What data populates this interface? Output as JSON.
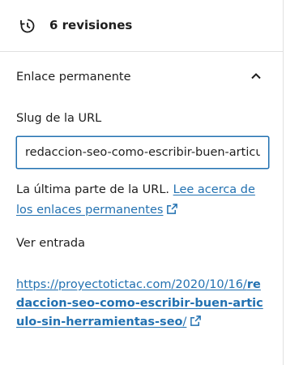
{
  "revisions": {
    "label": "6 revisiones",
    "icon": "history-icon"
  },
  "permalink_panel": {
    "title": "Enlace permanente",
    "toggle_icon": "chevron-up-icon",
    "slug_label": "Slug de la URL",
    "slug_value": "redaccion-seo-como-escribir-buen-articulo-sin-herramientas-seo",
    "help_text": "La última parte de la URL.",
    "help_link": "Lee acerca de los enlaces permanentes",
    "view_label": "Ver entrada",
    "url_prefix": "https://proyectotictac.com/2020/10/16/",
    "url_slug": "redaccion-seo-como-escribir-buen-articulo-sin-herramientas-seo",
    "url_suffix": "/",
    "external_icon": "external-link-icon"
  },
  "colors": {
    "link": "#2271b1",
    "text": "#1e1e1e",
    "border": "#e0e0e0"
  }
}
